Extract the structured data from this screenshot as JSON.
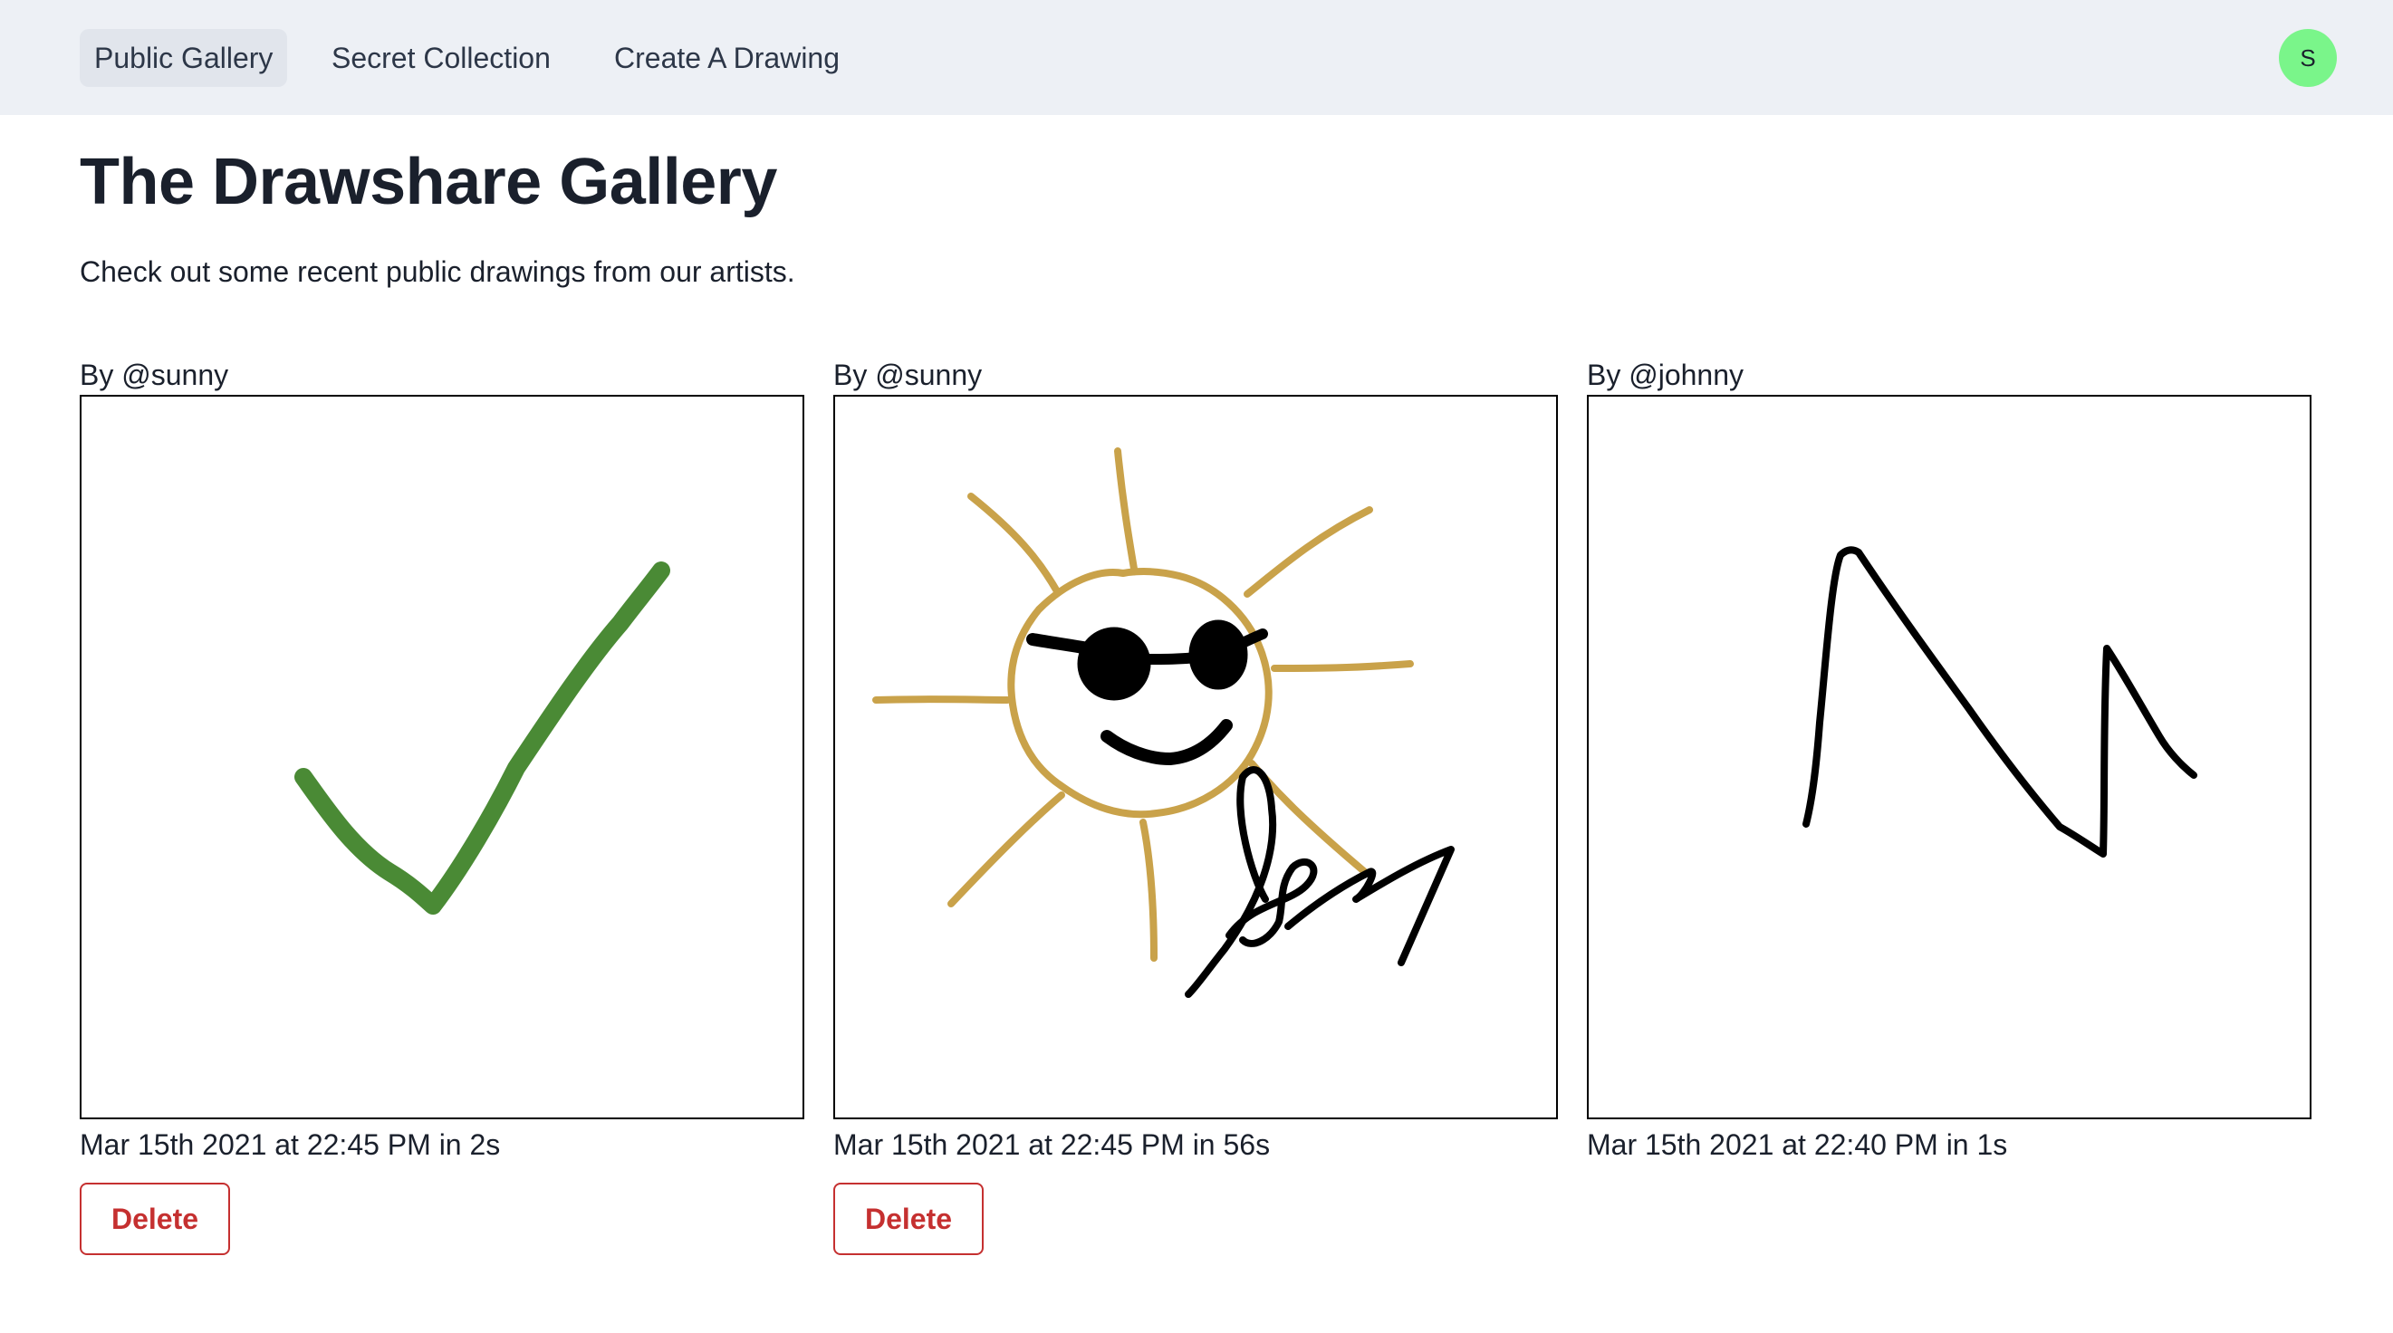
{
  "nav": {
    "tabs": [
      {
        "label": "Public Gallery",
        "active": true
      },
      {
        "label": "Secret Collection",
        "active": false
      },
      {
        "label": "Create A Drawing",
        "active": false
      }
    ],
    "avatar_initial": "S",
    "avatar_color": "#7af58a"
  },
  "page": {
    "title": "The Drawshare Gallery",
    "subtitle": "Check out some recent public drawings from our artists."
  },
  "drawings": [
    {
      "author": "By @sunny",
      "meta": "Mar 15th 2021 at 22:45 PM in 2s",
      "delete_label": "Delete",
      "drawing_icon": "checkmark-drawing",
      "stroke_color": "#4a8a35"
    },
    {
      "author": "By @sunny",
      "meta": "Mar 15th 2021 at 22:45 PM in 56s",
      "delete_label": "Delete",
      "drawing_icon": "sun-with-sunglasses-drawing",
      "stroke_color": "#c9a24a"
    },
    {
      "author": "By @johnny",
      "meta": "Mar 15th 2021 at 22:40 PM in 1s",
      "drawing_icon": "zigzag-drawing",
      "stroke_color": "#000000"
    }
  ],
  "colors": {
    "delete": "#c53030",
    "topbar": "#edf0f5"
  }
}
